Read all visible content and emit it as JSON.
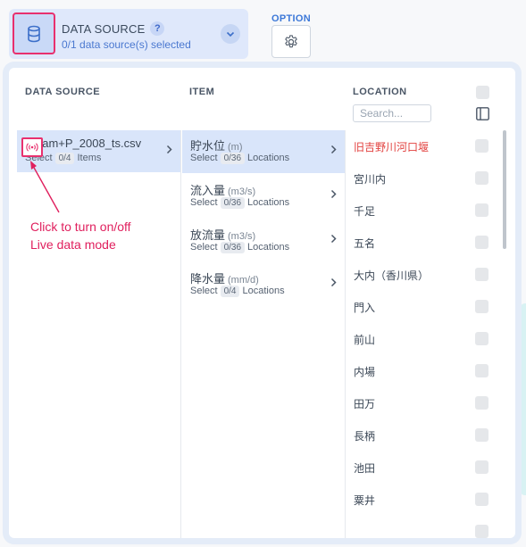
{
  "header": {
    "data_source_title": "DATA SOURCE",
    "help_badge": "?",
    "data_source_status": "0/1 data source(s) selected",
    "option_label": "OPTION"
  },
  "columns": {
    "data_source": "DATA SOURCE",
    "item": "ITEM",
    "location": "LOCATION"
  },
  "data_sources": [
    {
      "name": "dam+P_2008_ts.csv",
      "select_label": "Select",
      "count": "0/4",
      "unit_label": "Items"
    }
  ],
  "items": [
    {
      "name": "貯水位",
      "unit": "(m)",
      "select_label": "Select",
      "count": "0/36",
      "unit_label": "Locations"
    },
    {
      "name": "流入量",
      "unit": "(m3/s)",
      "select_label": "Select",
      "count": "0/36",
      "unit_label": "Locations"
    },
    {
      "name": "放流量",
      "unit": "(m3/s)",
      "select_label": "Select",
      "count": "0/36",
      "unit_label": "Locations"
    },
    {
      "name": "降水量",
      "unit": "(mm/d)",
      "select_label": "Select",
      "count": "0/4",
      "unit_label": "Locations"
    }
  ],
  "location_search": {
    "placeholder": "Search..."
  },
  "locations": [
    {
      "name": "旧吉野川河口堰",
      "highlighted": true
    },
    {
      "name": "宮川内"
    },
    {
      "name": "千足"
    },
    {
      "name": "五名"
    },
    {
      "name": "大内（香川県）"
    },
    {
      "name": "門入"
    },
    {
      "name": "前山"
    },
    {
      "name": "内場"
    },
    {
      "name": "田万"
    },
    {
      "name": "長柄"
    },
    {
      "name": "池田"
    },
    {
      "name": "粟井"
    }
  ],
  "annotation": {
    "line1": "Click to turn on/off",
    "line2": "Live data mode"
  },
  "icons": {
    "data_source_button": "database-icon",
    "dropdown": "chevron-down-icon",
    "option": "gear-icon",
    "live_mode": "broadcast-icon",
    "row_arrow": "chevron-right-icon",
    "panel_toggle": "sidebar-panel-icon"
  },
  "colors": {
    "accent": "#3c78d8",
    "highlight_border": "#e8306e",
    "selected_row": "#d9e5fa",
    "highlighted_location": "#e2413f"
  }
}
